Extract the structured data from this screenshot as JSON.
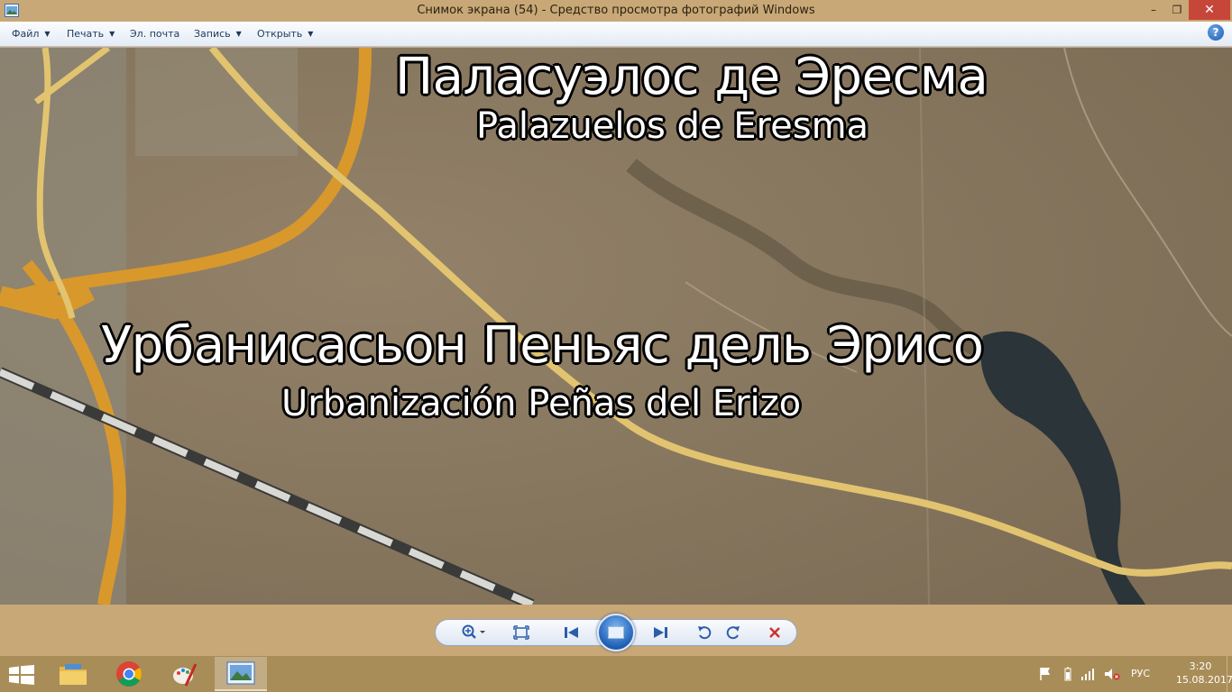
{
  "window": {
    "title": "Снимок экрана (54) - Средство просмотра фотографий Windows",
    "controls": {
      "minimize": "–",
      "maximize": "❐",
      "close": "✕"
    }
  },
  "menu": {
    "file": "Файл",
    "print": "Печать",
    "email": "Эл. почта",
    "burn": "Запись",
    "open": "Открыть",
    "help": "?"
  },
  "map": {
    "labels": {
      "palazuelos_ru": "Паласуэлос де Эресма",
      "palazuelos_es": "Palazuelos de Eresma",
      "penas_ru": "Урбанисасьон Пеньяс дель Эрисо",
      "penas_es": "Urbanización Peñas del Erizo"
    }
  },
  "toolbar": {
    "icons": [
      "zoom-icon",
      "fit-window-icon",
      "previous-icon",
      "slideshow-icon",
      "next-icon",
      "rotate-left-icon",
      "rotate-right-icon",
      "delete-icon"
    ]
  },
  "taskbar": {
    "apps": [
      "file-explorer-icon",
      "chrome-icon",
      "paint-icon",
      "photo-viewer-icon"
    ],
    "tray": {
      "language": "РУС",
      "time": "3:20",
      "date": "15.08.2017"
    }
  },
  "colors": {
    "titlebar": "#c9a877",
    "close_button": "#c7463a",
    "taskbar": "#a98d58",
    "toolbar_accent": "#2b5ea8"
  }
}
